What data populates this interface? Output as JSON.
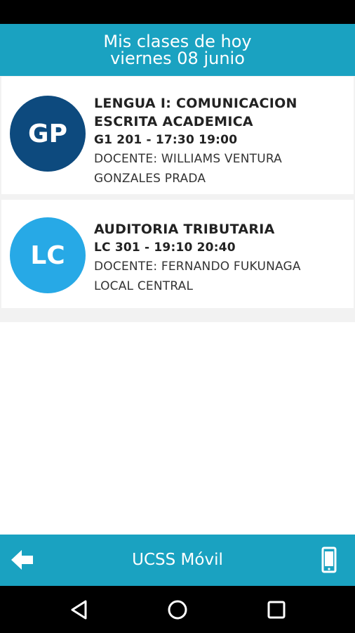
{
  "header": {
    "title": "Mis clases de hoy",
    "date": "viernes 08 junio"
  },
  "classes": [
    {
      "initials": "GP",
      "avatar_color": "#0d4a7e",
      "course": "LENGUA I: COMUNICACION ESCRITA ACADEMICA",
      "schedule": "G1 201 - 17:30 19:00",
      "teacher": "DOCENTE: WILLIAMS VENTURA",
      "location": "GONZALES PRADA"
    },
    {
      "initials": "LC",
      "avatar_color": "#27a9e6",
      "course": "AUDITORIA TRIBUTARIA",
      "schedule": "LC 301 - 19:10 20:40",
      "teacher": "DOCENTE: FERNANDO FUKUNAGA",
      "location": "LOCAL CENTRAL"
    }
  ],
  "bottom_bar": {
    "title": "UCSS Móvil",
    "back_icon": "arrow-left-icon",
    "device_icon": "smartphone-icon"
  },
  "navigation": {
    "back_icon": "triangle-back-icon",
    "home_icon": "circle-home-icon",
    "recent_icon": "square-recents-icon"
  },
  "colors": {
    "primary": "#1aa2c1",
    "status_bar": "#000000",
    "nav_bar": "#000000"
  }
}
